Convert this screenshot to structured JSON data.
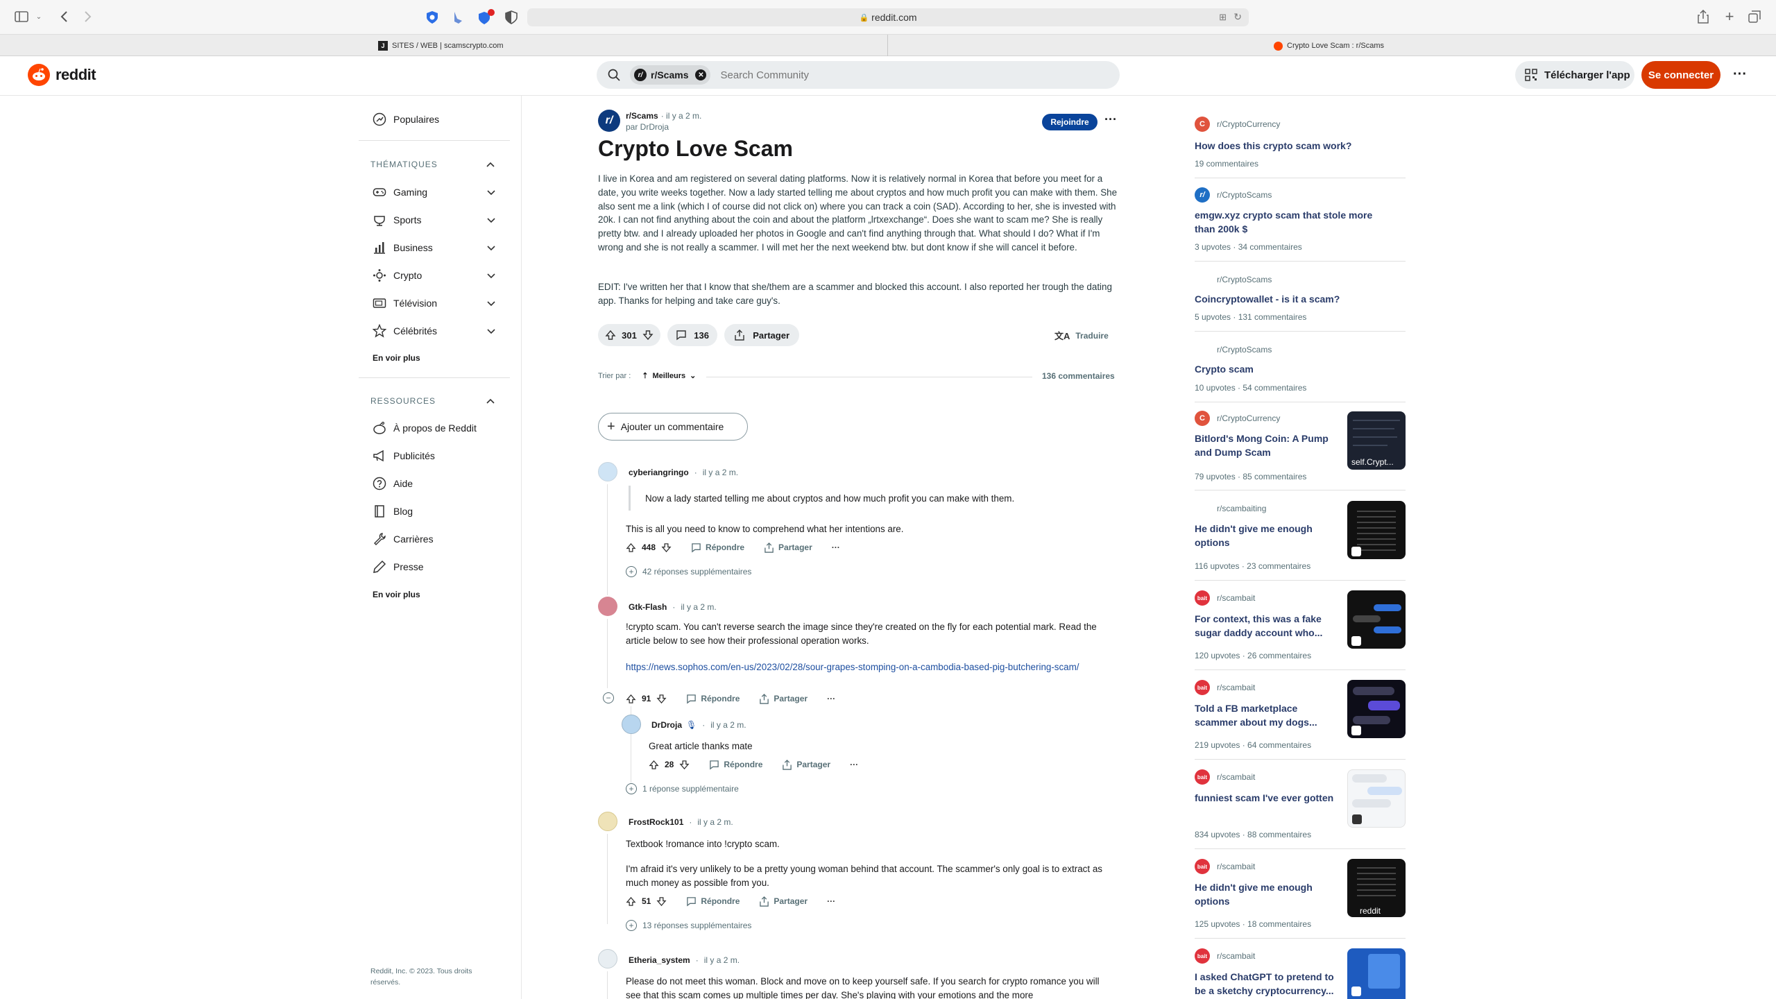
{
  "browser": {
    "url": "reddit.com",
    "tab_left": "SITES / WEB | scamscrypto.com",
    "tab_right": "Crypto Love Scam : r/Scams"
  },
  "header": {
    "logo_text": "reddit",
    "search_chip": "r/Scams",
    "search_placeholder": "Search Community",
    "download_label": "Télécharger l'app",
    "login_label": "Se connecter",
    "more": "···"
  },
  "left_nav": {
    "popular": "Populaires",
    "topics_title": "THÉMATIQUES",
    "topics": [
      "Gaming",
      "Sports",
      "Business",
      "Crypto",
      "Télévision",
      "Célébrités"
    ],
    "topics_more": "En voir plus",
    "resources_title": "RESSOURCES",
    "resources": [
      "À propos de Reddit",
      "Publicités",
      "Aide",
      "Blog",
      "Carrières",
      "Presse"
    ],
    "resources_more": "En voir plus",
    "footer": "Reddit, Inc. © 2023. Tous droits réservés."
  },
  "post": {
    "subreddit": "r/Scams",
    "time": "· il y a 2 m.",
    "author": "par DrDroja",
    "join_label": "Rejoindre",
    "title": "Crypto Love Scam",
    "body_p1": "I live in Korea and am registered on several dating platforms. Now it is relatively normal in Korea that before you meet for a date, you write weeks together. Now a lady started telling me about cryptos and how much profit you can make with them. She also sent me a link (which I of course did not click on) where you can track a coin (SAD). According to her, she is invested with 20k. I can not find anything about the coin and about the platform „lrtxexchange“. Does she want to scam me? She is really pretty btw. and I already uploaded her photos in Google and can't find anything through that. What should I do? What if I'm wrong and she is not really a scammer. I will met her the next weekend btw. but dont know if she will cancel it before.",
    "body_p2": "EDIT: I've written her that I know that she/them are a scammer and blocked this account. I also reported her trough the dating app. Thanks for helping and take care guy's.",
    "votes": "301",
    "comments": "136",
    "share_label": "Partager",
    "translate_label": "Traduire",
    "sort_prefix": "Trier par :",
    "sort_value": "Meilleurs",
    "comments_count_label": "136 commentaires",
    "add_comment_label": "Ajouter un commentaire"
  },
  "comments": [
    {
      "user": "cyberiangringo",
      "time": "il y a 2 m.",
      "quote": "Now a lady started telling me about cryptos and how much profit you can make with them.",
      "text": "This is all you need to know to comprehend what her intentions are.",
      "votes": "448",
      "reply": "Répondre",
      "share": "Partager",
      "more_replies": "42 réponses supplémentaires"
    },
    {
      "user": "Gtk-Flash",
      "time": "il y a 2 m.",
      "text": "!crypto scam. You can't reverse search the image since they're created on the fly for each potential mark. Read the article below to see how their professional operation works.",
      "link": "https://news.sophos.com/en-us/2023/02/28/sour-grapes-stomping-on-a-cambodia-based-pig-butchering-scam/",
      "votes": "91",
      "reply": "Répondre",
      "share": "Partager"
    },
    {
      "user": "DrDroja",
      "time": "il y a 2 m.",
      "text": "Great article thanks mate",
      "votes": "28",
      "reply": "Répondre",
      "share": "Partager",
      "more_replies": "1 réponse supplémentaire"
    },
    {
      "user": "FrostRock101",
      "time": "il y a 2 m.",
      "text": "Textbook !romance into !crypto scam.",
      "text2": "I'm afraid it's very unlikely to be a pretty young woman behind that account. The scammer's only goal is to extract as much money as possible from you.",
      "votes": "51",
      "reply": "Répondre",
      "share": "Partager",
      "more_replies": "13 réponses supplémentaires"
    },
    {
      "user": "Etheria_system",
      "time": "il y a 2 m.",
      "text": "Please do not meet this woman. Block and move on to keep yourself safe. If you search for crypto romance you will see that this scam comes up multiple times per day. She's playing with your emotions and the more"
    }
  ],
  "related": [
    {
      "sub": "r/CryptoCurrency",
      "title": "How does this crypto scam work?",
      "meta": "19 commentaires",
      "icon_color": "#e0533d"
    },
    {
      "sub": "r/CryptoScams",
      "title": "emgw.xyz crypto scam that stole more than 200k $",
      "meta": "3 upvotes · 34 commentaires",
      "icon_color": "#1f6fc5"
    },
    {
      "sub": "r/CryptoScams",
      "title": "Coincryptowallet - is it a scam?",
      "meta": "5 upvotes · 131 commentaires",
      "icon_color": ""
    },
    {
      "sub": "r/CryptoScams",
      "title": "Crypto scam",
      "meta": "10 upvotes · 54 commentaires",
      "icon_color": ""
    },
    {
      "sub": "r/CryptoCurrency",
      "title": "Bitlord's Mong Coin: A Pump and Dump Scam",
      "meta": "79 upvotes · 85 commentaires",
      "icon_color": "#e0533d",
      "thumb_label": "self.Crypt..."
    },
    {
      "sub": "r/scambaiting",
      "title": "He didn't give me enough options",
      "meta": "116 upvotes · 23 commentaires",
      "icon_color": ""
    },
    {
      "sub": "r/scambait",
      "title": "For context, this was a fake sugar daddy account who...",
      "meta": "120 upvotes · 26 commentaires",
      "icon_color": "#e0333d"
    },
    {
      "sub": "r/scambait",
      "title": "Told a FB marketplace scammer about my dogs...",
      "meta": "219 upvotes · 64 commentaires",
      "icon_color": "#e0333d"
    },
    {
      "sub": "r/scambait",
      "title": "funniest scam I've ever gotten",
      "meta": "834 upvotes · 88 commentaires",
      "icon_color": "#e0333d"
    },
    {
      "sub": "r/scambait",
      "title": "He didn't give me enough options",
      "meta": "125 upvotes · 18 commentaires",
      "icon_color": "#e0333d",
      "thumb_label": "reddit"
    },
    {
      "sub": "r/scambait",
      "title": "I asked ChatGPT to pretend to be a sketchy cryptocurrency...",
      "meta": "",
      "icon_color": "#e0333d"
    }
  ]
}
